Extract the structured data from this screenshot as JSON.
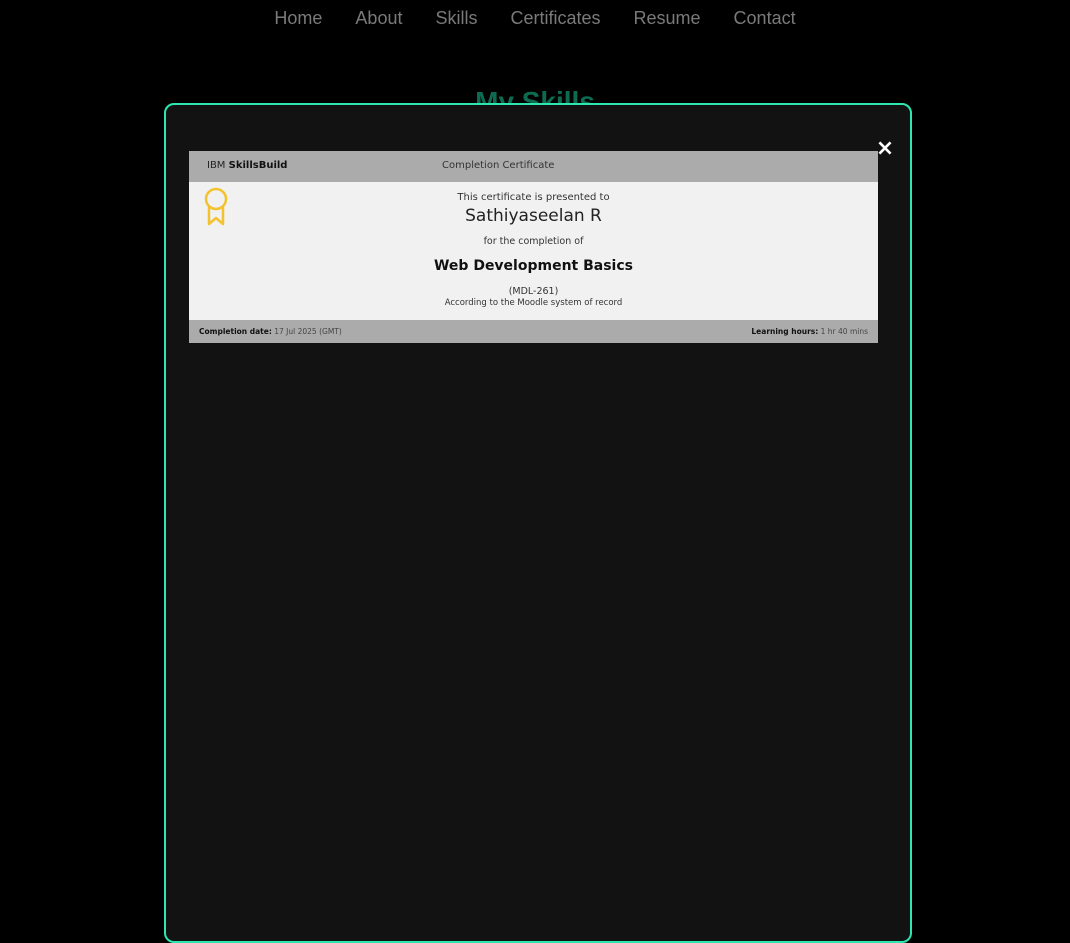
{
  "nav": {
    "items": [
      "Home",
      "About",
      "Skills",
      "Certificates",
      "Resume",
      "Contact"
    ]
  },
  "section": {
    "title": "My Skills"
  },
  "modal": {
    "close_label": "×",
    "certificate": {
      "brand_prefix": "IBM",
      "brand_name": "SkillsBuild",
      "type": "Completion Certificate",
      "presented_text": "This certificate is presented to",
      "recipient": "Sathiyaseelan R",
      "completion_text": "for the completion of",
      "course": "Web Development Basics",
      "code": "(MDL-261)",
      "record_text": "According to the Moodle system of record",
      "completion_date_label": "Completion date:",
      "completion_date": "17 Jul 2025 (GMT)",
      "learning_hours_label": "Learning hours:",
      "learning_hours": "1 hr 40 mins"
    }
  },
  "colors": {
    "background": "#000000",
    "modal_border": "#2ee6b0",
    "modal_bg": "#121212",
    "nav_text": "#7a7a7a",
    "title_text": "#0d6b52",
    "ribbon": "#f2c230"
  }
}
